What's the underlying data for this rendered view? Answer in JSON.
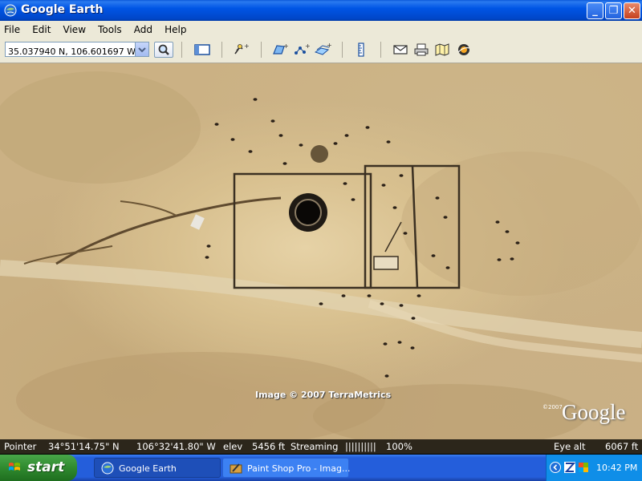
{
  "window": {
    "title": "Google Earth",
    "minimize_label": "_",
    "maximize_label": "❐",
    "close_label": "✕"
  },
  "menu": {
    "items": [
      "File",
      "Edit",
      "View",
      "Tools",
      "Add",
      "Help"
    ]
  },
  "toolbar": {
    "search_value": "35.037940 N, 106.601697 W",
    "icons": [
      "search-icon",
      "sidebar-toggle-icon",
      "placemark-icon",
      "polygon-icon",
      "path-icon",
      "image-overlay-icon",
      "ruler-icon",
      "email-icon",
      "print-icon",
      "google-maps-icon",
      "sky-icon"
    ]
  },
  "map": {
    "credit": "Image © 2007 TerraMetrics",
    "logo": "Google",
    "logo_year": "©2007"
  },
  "status": {
    "pointer_label": "Pointer",
    "lat": "34°51'14.75\" N",
    "lon": "106°32'41.80\" W",
    "elev_label": "elev",
    "elev_value": "5456 ft",
    "streaming_label": "Streaming",
    "streaming_bar": "||||||||||",
    "streaming_percent": "100%",
    "eye_alt_label": "Eye alt",
    "eye_alt_value": "6067 ft"
  },
  "taskbar": {
    "start_label": "start",
    "tasks": [
      {
        "label": "Google Earth"
      },
      {
        "label": "Paint Shop Pro - Imag..."
      }
    ],
    "clock": "10:42 PM"
  }
}
